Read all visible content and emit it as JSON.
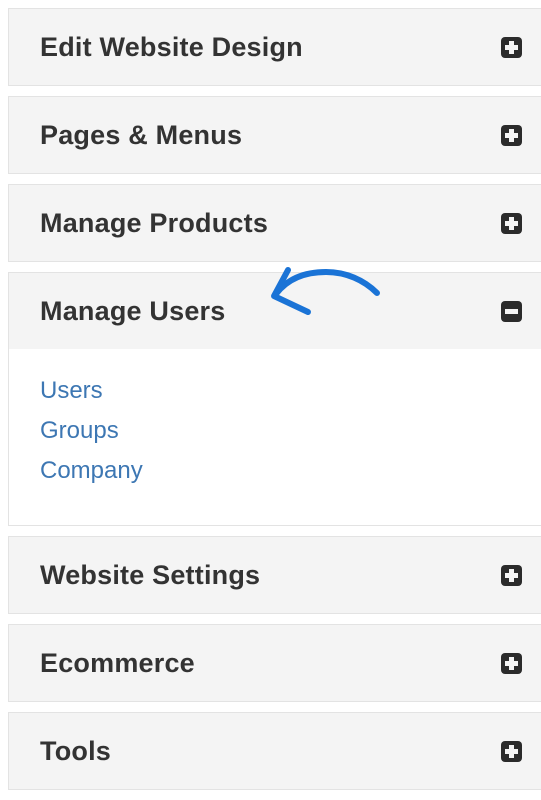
{
  "menu": {
    "sections": [
      {
        "title": "Edit Website Design",
        "state": "collapsed",
        "toggle_icon": "plus-square-icon"
      },
      {
        "title": "Pages & Menus",
        "state": "collapsed",
        "toggle_icon": "plus-square-icon"
      },
      {
        "title": "Manage Products",
        "state": "collapsed",
        "toggle_icon": "plus-square-icon"
      },
      {
        "title": "Manage Users",
        "state": "expanded",
        "toggle_icon": "minus-square-icon",
        "links": [
          {
            "label": "Users"
          },
          {
            "label": "Groups"
          },
          {
            "label": "Company"
          }
        ]
      },
      {
        "title": "Website Settings",
        "state": "collapsed",
        "toggle_icon": "plus-square-icon"
      },
      {
        "title": "Ecommerce",
        "state": "collapsed",
        "toggle_icon": "plus-square-icon"
      },
      {
        "title": "Tools",
        "state": "collapsed",
        "toggle_icon": "plus-square-icon"
      }
    ]
  },
  "annotation": {
    "icon": "hand-drawn-arrow-icon",
    "color": "#1a73d6"
  },
  "colors": {
    "panel_background": "#f4f4f4",
    "title_text": "#333333",
    "link_text": "#3d77b3",
    "toggle_icon": "#2b2b2b"
  }
}
